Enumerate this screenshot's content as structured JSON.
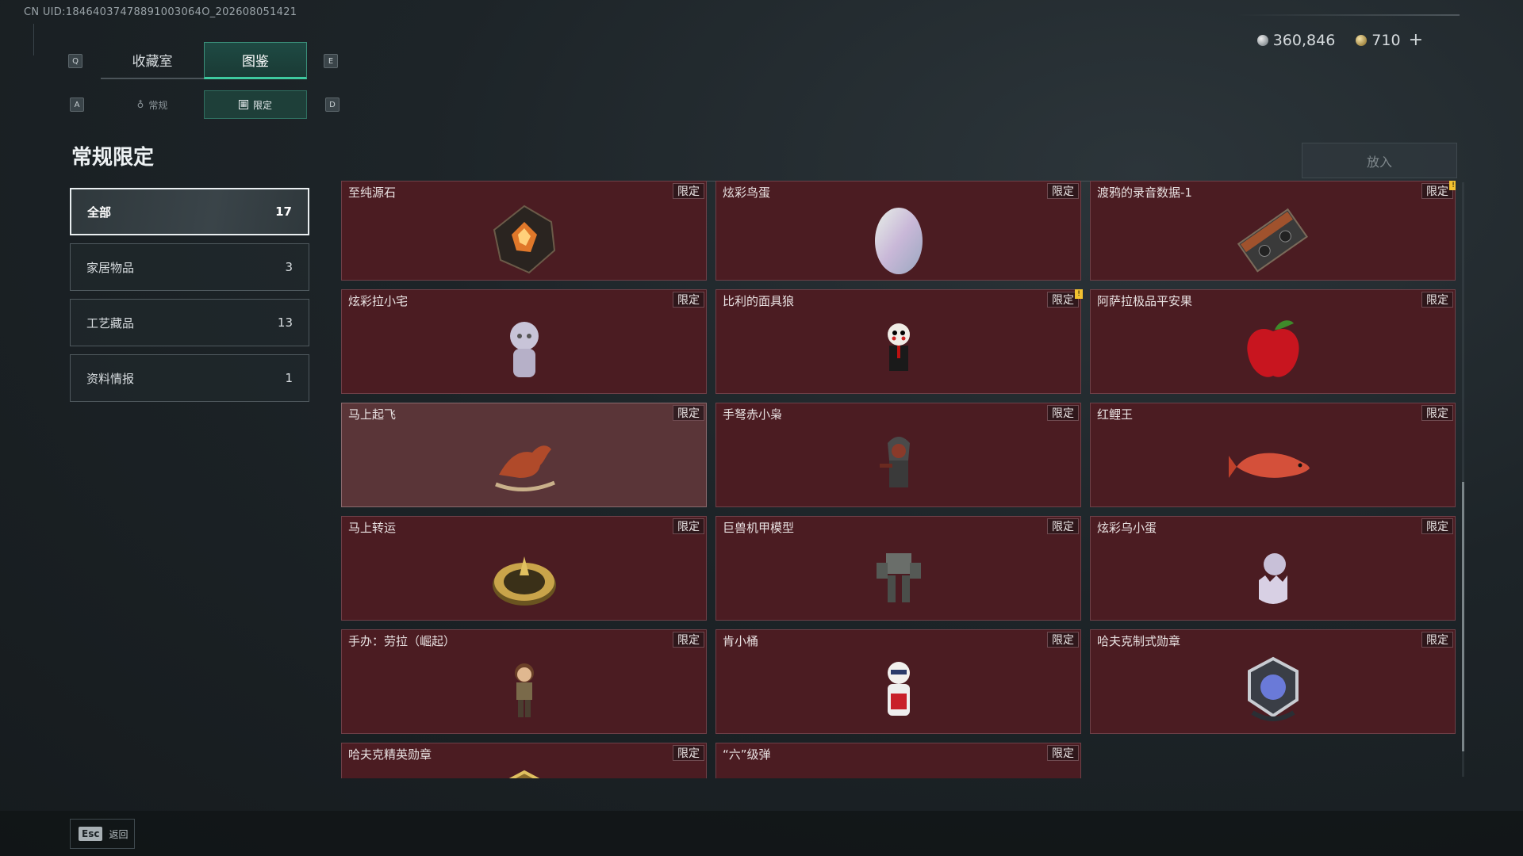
{
  "uid_text": "CN UID:18464037478891003064O_202608051421",
  "currency": {
    "silver": "360,846",
    "gold": "710",
    "plus": "+"
  },
  "keys": {
    "q": "Q",
    "e": "E",
    "a": "A",
    "d": "D",
    "esc": "Esc"
  },
  "main_tabs": [
    {
      "label": "收藏室"
    },
    {
      "label": "图鉴"
    }
  ],
  "sub_tabs": [
    {
      "label": "常规"
    },
    {
      "label": "限定"
    }
  ],
  "page_title": "常规限定",
  "put_button": "放入",
  "categories": [
    {
      "label": "全部",
      "count": "17"
    },
    {
      "label": "家居物品",
      "count": "3"
    },
    {
      "label": "工艺藏品",
      "count": "13"
    },
    {
      "label": "资料情报",
      "count": "1"
    }
  ],
  "badge": "限定",
  "items": [
    {
      "name": "至纯源石",
      "icon": "crystal-icon"
    },
    {
      "name": "炫彩鸟蛋",
      "icon": "egg-icon"
    },
    {
      "name": "渡鸦的录音数据-1",
      "icon": "cassette-icon"
    },
    {
      "name": "炫彩拉小宅",
      "icon": "figure-icon"
    },
    {
      "name": "比利的面具狼",
      "icon": "puppet-icon"
    },
    {
      "name": "阿萨拉极品平安果",
      "icon": "apple-icon"
    },
    {
      "name": "马上起飞",
      "icon": "horse-icon"
    },
    {
      "name": "手弩赤小枭",
      "icon": "hooded-figure-icon"
    },
    {
      "name": "红鲤王",
      "icon": "carp-icon"
    },
    {
      "name": "马上转运",
      "icon": "compass-icon"
    },
    {
      "name": "巨兽机甲模型",
      "icon": "mech-icon"
    },
    {
      "name": "炫彩乌小蛋",
      "icon": "hatchling-icon"
    },
    {
      "name": "手办：劳拉（崛起）",
      "icon": "lara-figure-icon"
    },
    {
      "name": "肯小桶",
      "icon": "colonel-figure-icon"
    },
    {
      "name": "哈夫克制式勋章",
      "icon": "medal-icon"
    },
    {
      "name": "哈夫克精英勋章",
      "icon": "elite-medal-icon"
    },
    {
      "name": "“六”级弹",
      "icon": "bullet-icon"
    }
  ],
  "footer": {
    "back_label": "返回"
  },
  "colors": {
    "card_bg": "#4b1c22",
    "accent": "#3ec99f",
    "highlight_card": "#5a3538"
  }
}
